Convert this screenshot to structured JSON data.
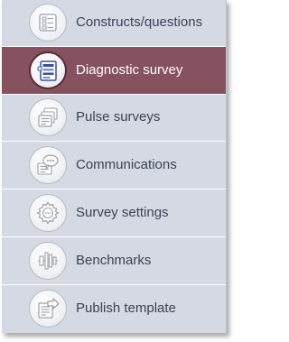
{
  "nav": {
    "items": [
      {
        "label": "Constructs/questions",
        "icon": "constructs-icon",
        "active": false
      },
      {
        "label": "Diagnostic survey",
        "icon": "diagnostic-survey-icon",
        "active": true
      },
      {
        "label": "Pulse surveys",
        "icon": "pulse-surveys-icon",
        "active": false
      },
      {
        "label": "Communications",
        "icon": "communications-icon",
        "active": false
      },
      {
        "label": "Survey settings",
        "icon": "survey-settings-icon",
        "active": false
      },
      {
        "label": "Benchmarks",
        "icon": "benchmarks-icon",
        "active": false
      },
      {
        "label": "Publish template",
        "icon": "publish-template-icon",
        "active": false
      }
    ]
  },
  "colors": {
    "panel_bg": "#d4d9e3",
    "active_bg": "#865260",
    "label_text": "#3c4254",
    "active_label_text": "#ffffff",
    "icon_stroke": "#9aa0ad",
    "active_icon_accent": "#3b4fa8"
  }
}
